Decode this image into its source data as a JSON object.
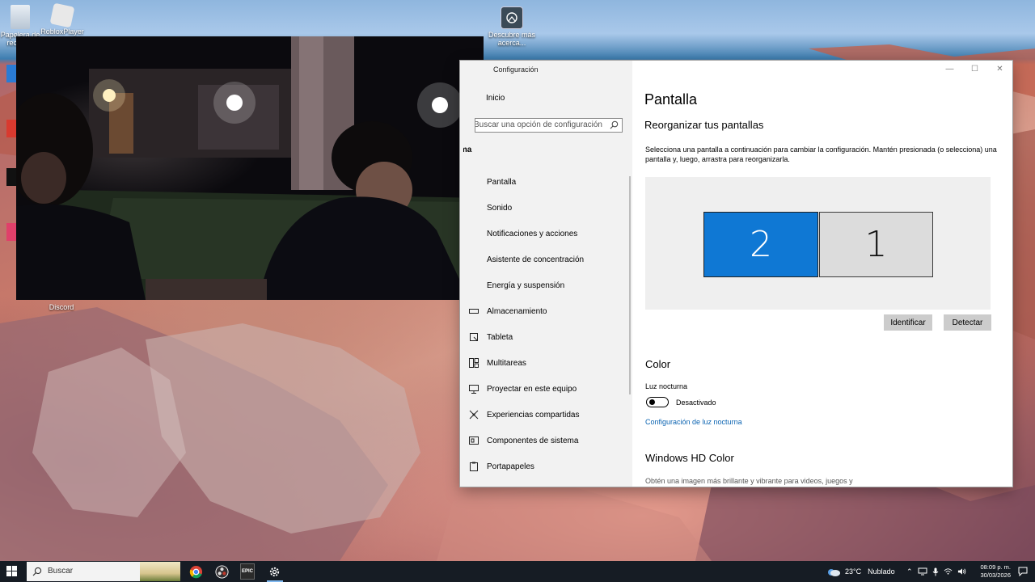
{
  "desktop": {
    "icons": [
      {
        "label": "Papelera de reciclaje",
        "icon": "recycle-bin-icon"
      },
      {
        "label": "RobloxPlayer",
        "icon": "roblox-icon"
      },
      {
        "label": "Descubre más acerca...",
        "icon": "spotlight-icon"
      },
      {
        "label": "Discord",
        "icon": "discord-icon"
      }
    ]
  },
  "settings": {
    "window_title": "Configuración",
    "controls": {
      "minimize": "—",
      "maximize": "☐",
      "close": "✕"
    },
    "home_label": "Inicio",
    "search_placeholder": "Buscar una opción de configuración",
    "section": "Sistema",
    "nav": [
      {
        "label": "Pantalla",
        "icon": "display-icon"
      },
      {
        "label": "Sonido",
        "icon": "sound-icon"
      },
      {
        "label": "Notificaciones y acciones",
        "icon": "notifications-icon"
      },
      {
        "label": "Asistente de concentración",
        "icon": "focus-assist-icon"
      },
      {
        "label": "Energía y suspensión",
        "icon": "power-icon"
      },
      {
        "label": "Almacenamiento",
        "icon": "storage-icon"
      },
      {
        "label": "Tableta",
        "icon": "tablet-icon"
      },
      {
        "label": "Multitareas",
        "icon": "multitasking-icon"
      },
      {
        "label": "Proyectar en este equipo",
        "icon": "projecting-icon"
      },
      {
        "label": "Experiencias compartidas",
        "icon": "shared-experiences-icon"
      },
      {
        "label": "Componentes de sistema",
        "icon": "system-components-icon"
      },
      {
        "label": "Portapapeles",
        "icon": "clipboard-icon"
      }
    ],
    "page_title": "Pantalla",
    "rearrange_title": "Reorganizar tus pantallas",
    "rearrange_desc": "Selecciona una pantalla a continuación para cambiar la configuración. Mantén presionada (o selecciona) una pantalla y, luego, arrastra para reorganizarla.",
    "monitors": [
      {
        "label": "2",
        "selected": true
      },
      {
        "label": "1",
        "selected": false
      }
    ],
    "identify_label": "Identificar",
    "detect_label": "Detectar",
    "color_title": "Color",
    "night_light_label": "Luz nocturna",
    "night_light_state": "Desactivado",
    "night_light_link": "Configuración de luz nocturna",
    "hd_title": "Windows HD Color",
    "hd_desc": "Obtén una imagen más brillante y vibrante para videos, juegos y"
  },
  "taskbar": {
    "search_label": "Buscar",
    "apps": [
      "chrome-icon",
      "obs-icon",
      "epic-games-icon",
      "settings-gear-icon"
    ],
    "epic_label": "EPIC",
    "weather": {
      "temp": "23°C",
      "condition": "Nublado"
    },
    "time": "08:09 p. m.",
    "date": "30/03/2026"
  },
  "colors": {
    "accent": "#0f78d4",
    "taskbar": "#161c24",
    "sidebar": "#f2f2f2",
    "link": "#0a63b1"
  }
}
